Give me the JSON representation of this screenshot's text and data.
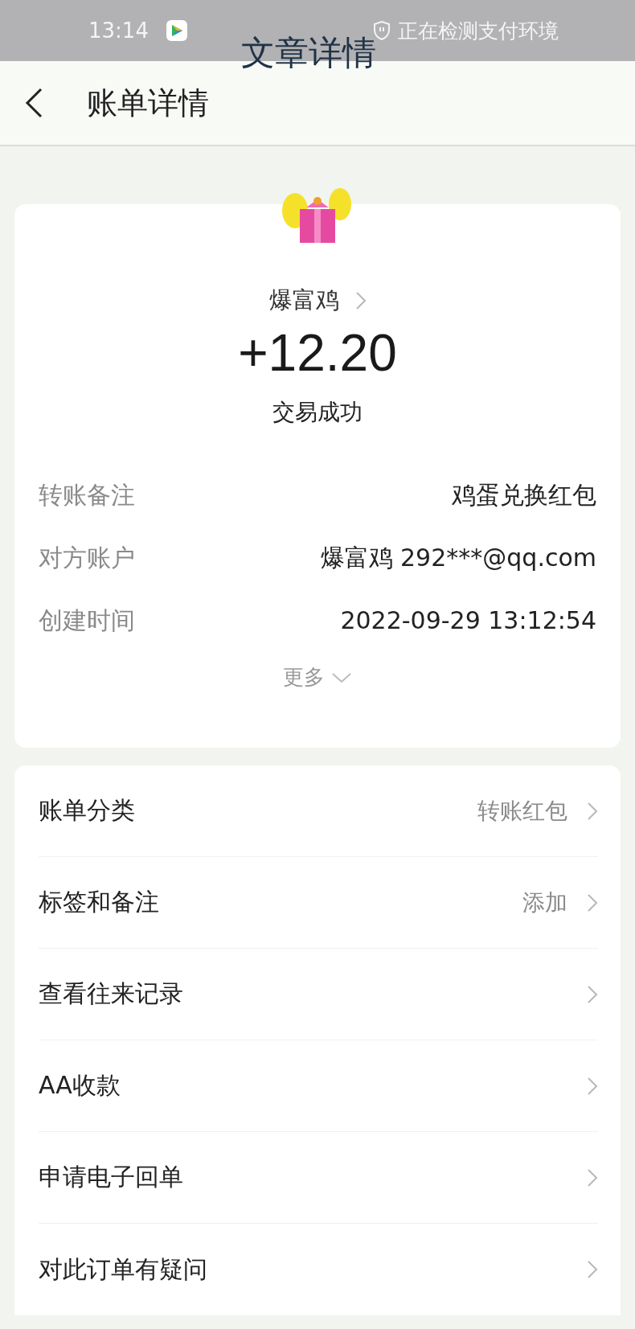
{
  "status_bar": {
    "time": "13:14",
    "notice": "正在检测支付环境"
  },
  "overlay_title": "文章详情",
  "header": {
    "title": "账单详情"
  },
  "summary": {
    "payee": "爆富鸡",
    "amount": "+12.20",
    "status": "交易成功",
    "details": [
      {
        "label": "转账备注",
        "value": "鸡蛋兑换红包"
      },
      {
        "label": "对方账户",
        "value": "爆富鸡 292***@qq.com"
      },
      {
        "label": "创建时间",
        "value": "2022-09-29 13:12:54"
      }
    ],
    "more": "更多"
  },
  "menu": [
    {
      "label": "账单分类",
      "value": "转账红包"
    },
    {
      "label": "标签和备注",
      "value": "添加"
    },
    {
      "label": "查看往来记录"
    },
    {
      "label": "AA收款"
    },
    {
      "label": "申请电子回单"
    },
    {
      "label": "对此订单有疑问"
    }
  ]
}
